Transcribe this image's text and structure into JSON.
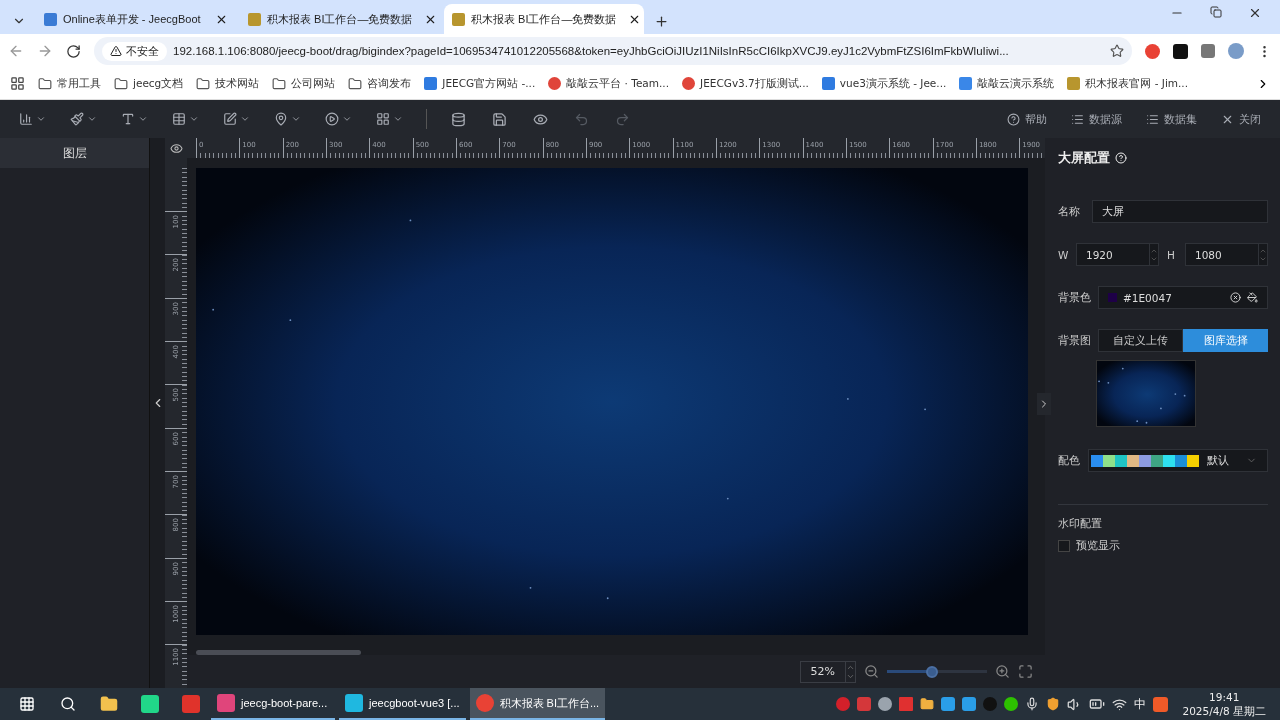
{
  "browser": {
    "tabs": [
      {
        "title": "Online表单开发 - JeecgBoot",
        "kind": "jeecg",
        "selected": false
      },
      {
        "title": "积木报表 BI工作台—免费数据",
        "kind": "jimu",
        "selected": false
      },
      {
        "title": "积木报表 BI工作台—免费数据",
        "kind": "jimu",
        "selected": true
      }
    ],
    "security": "不安全",
    "url": "192.168.1.106:8080/jeecg-boot/drag/bigindex?pageId=1069534741012205568&token=eyJhbGciOiJIUzI1NiIsInR5cCI6IkpXVCJ9.eyJ1c2VybmFtZSI6ImFkbWluIiwi...",
    "bookmarks": [
      {
        "label": "常用工具",
        "kind": "folder"
      },
      {
        "label": "jeecg文档",
        "kind": "folder"
      },
      {
        "label": "技术网站",
        "kind": "folder"
      },
      {
        "label": "公司网站",
        "kind": "folder"
      },
      {
        "label": "咨询发布",
        "kind": "folder"
      },
      {
        "label": "JEECG官方网站 -...",
        "kind": "jeecg"
      },
      {
        "label": "敲敲云平台 · Team...",
        "kind": "badge"
      },
      {
        "label": "JEECGv3.7打版测试...",
        "kind": "badge"
      },
      {
        "label": "vue3演示系统 - Jee...",
        "kind": "jeecg"
      },
      {
        "label": "敲敲云演示系统",
        "kind": "square"
      },
      {
        "label": "积木报表官网 - Jim...",
        "kind": "jimu"
      }
    ]
  },
  "toolbar": {
    "menus": [
      {
        "kind": "chart"
      },
      {
        "kind": "brush"
      },
      {
        "kind": "text"
      },
      {
        "kind": "table"
      },
      {
        "kind": "edit"
      },
      {
        "kind": "map"
      },
      {
        "kind": "media"
      },
      {
        "kind": "grid"
      }
    ],
    "actions": [
      {
        "kind": "database",
        "disabled": false
      },
      {
        "kind": "save",
        "disabled": false
      },
      {
        "kind": "preview",
        "disabled": false
      },
      {
        "kind": "undo",
        "disabled": true
      },
      {
        "kind": "redo",
        "disabled": true
      }
    ],
    "links": [
      {
        "label": "帮助",
        "kind": "help"
      },
      {
        "label": "数据源",
        "kind": "datasource"
      },
      {
        "label": "数据集",
        "kind": "dataset"
      },
      {
        "label": "关闭",
        "kind": "close"
      }
    ]
  },
  "layers": {
    "title": "图层"
  },
  "ruler": {
    "horizontal": [
      "0",
      "100",
      "200",
      "300",
      "400",
      "500",
      "600",
      "700",
      "800",
      "900",
      "1000",
      "1100",
      "1200",
      "1300",
      "1400",
      "1500",
      "1600",
      "1700",
      "1800",
      "1900"
    ],
    "vertical": [
      "100",
      "200",
      "300",
      "400",
      "500",
      "600",
      "700",
      "800",
      "900",
      "1000",
      "1100"
    ]
  },
  "config": {
    "title": "大屏配置",
    "name": {
      "label": "名称",
      "value": "大屏"
    },
    "width": {
      "label": "W",
      "value": "1920"
    },
    "height": {
      "label": "H",
      "value": "1080"
    },
    "bg_color": {
      "label": "背景色",
      "value": "#1E0047"
    },
    "bg_image": {
      "label": "背景图",
      "options": [
        {
          "label": "自定义上传",
          "selected": false
        },
        {
          "label": "图库选择",
          "selected": true
        }
      ]
    },
    "palette": {
      "label": "配色",
      "value": "默认",
      "swatches": [
        {
          "color": "#2a8ef0"
        },
        {
          "color": "#8fe08a"
        },
        {
          "color": "#1fc4c4"
        },
        {
          "color": "#e0b884"
        },
        {
          "color": "#8c9be0"
        },
        {
          "color": "#3ea584"
        },
        {
          "color": "#2ee0f0"
        },
        {
          "color": "#1b8fd8"
        },
        {
          "color": "#f5d000"
        }
      ]
    },
    "watermark": {
      "title": "水印配置",
      "preview": {
        "label": "预览显示",
        "checked": false
      }
    }
  },
  "zoom": {
    "value": "52%",
    "level": 0.45
  },
  "taskbar": {
    "pinned": [
      {
        "kind": "start"
      },
      {
        "kind": "search"
      },
      {
        "kind": "files"
      },
      {
        "kind": "pycharm"
      },
      {
        "kind": "wps"
      }
    ],
    "windows": [
      {
        "label": "jeecg-boot-pare...",
        "kind": "idea",
        "selected": false
      },
      {
        "label": "jeecgboot-vue3 [...",
        "kind": "ws",
        "selected": false
      },
      {
        "label": "积木报表 BI工作台...",
        "kind": "chrome",
        "selected": true
      }
    ],
    "tray": [
      {
        "kind": "record"
      },
      {
        "kind": "app"
      },
      {
        "kind": "rings"
      },
      {
        "kind": "signal"
      },
      {
        "kind": "folder"
      },
      {
        "kind": "app-blue"
      },
      {
        "kind": "app-blue"
      },
      {
        "kind": "vpn"
      },
      {
        "kind": "chat"
      },
      {
        "kind": "mic"
      },
      {
        "kind": "shield"
      },
      {
        "kind": "volume"
      },
      {
        "kind": "battery"
      },
      {
        "kind": "wifi"
      }
    ],
    "ime": "中",
    "tray_end": [
      {
        "kind": "sogou"
      }
    ],
    "time": "19:41",
    "date": "2025/4/8 星期二"
  }
}
